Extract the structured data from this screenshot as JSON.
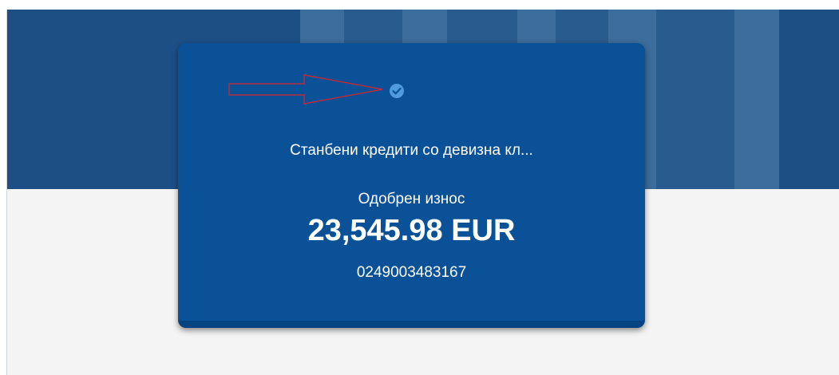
{
  "card": {
    "title": "Станбени кредити со девизна кл...",
    "amount_label": "Одобрен износ",
    "amount_value": "23,545.98 EUR",
    "account_number": "0249003483167",
    "status_icon": "check-circle-icon"
  },
  "annotation": {
    "icon": "red-arrow-icon"
  },
  "colors": {
    "header_band": "#1d4f85",
    "card_background": "#0a5198",
    "card_text": "#ffffff",
    "check_icon": "#4f9ae0",
    "arrow_outline": "#d9242b",
    "page_background": "#f4f4f4"
  }
}
